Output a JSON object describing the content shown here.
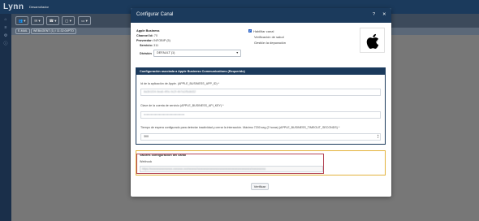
{
  "app": {
    "logo": "Lynn",
    "user": "Desarrollador",
    "toolbar": [
      {
        "label": "👥 ▾",
        "icon": "users-icon"
      },
      {
        "label": "✉ ▾",
        "icon": "mail-icon"
      },
      {
        "label": "☎ ▾",
        "icon": "phone-icon"
      },
      {
        "label": "▢ ▾",
        "icon": "window-icon"
      },
      {
        "label": "▭ ▾",
        "icon": "screen-icon"
      }
    ],
    "tabs": [
      "E-MAIL",
      "WEBAGENT (1) / 11:32:04PTO"
    ]
  },
  "modal": {
    "title": "Configurar Canal",
    "info": {
      "name": "Apple Business",
      "channel_id_label": "Channel Id:",
      "channel_id": "70",
      "provider_label": "Proveedor:",
      "provider": "INFOBIP (5)",
      "service_label": "Servicio:",
      "service": "311"
    },
    "division": {
      "label": "División",
      "value": "DEFAULT (1)"
    },
    "checkboxes": {
      "enable_label": "Habilitar canal",
      "health_label": "Verificación de salud",
      "monitor_label": "Gestión la depuración"
    },
    "config_panel": {
      "title": "Configuración asociada a Apple Business Communications (Requerido)",
      "fields": [
        {
          "label": "Id de la aplicación de Apple. (APPLE_BUSINESS_APP_ID) *",
          "value": "8a3b1f24-9ea6-4f0c-9c2f-4b7a1f5c8d32"
        },
        {
          "label": "Clave de la cuenta de servicio (APPLE_BUSINESS_API_KEY) *",
          "value": "••••••••••••••••••••••••••••••••••••••••"
        },
        {
          "label": "Tiempo de espera configurado para detectar inactividad y cerrar la interacción. Máximo 7200 seg (2 horas) (APPLE_BUSINESS_TIMEOUT_SECONDS) *",
          "value": "300"
        }
      ]
    },
    "values_panel": {
      "title": "Valores configuración del canal",
      "webhook_label": "Webhook",
      "webhook_value": "https://xxxxxxxxxxxxxxxx.xxxxxxx.xxx/xxxxxx/xxxxxxxxxxxxxxxxxxxxxxxxxxxxxxxxxxxxxxx/xxxxxxxxxx"
    },
    "verify_label": "Verificar"
  },
  "colors": {
    "header": "#1b3a5c",
    "accent_border": "#e3b23c",
    "highlight": "#b54a5a",
    "checkbox": "#2f6fdc"
  }
}
